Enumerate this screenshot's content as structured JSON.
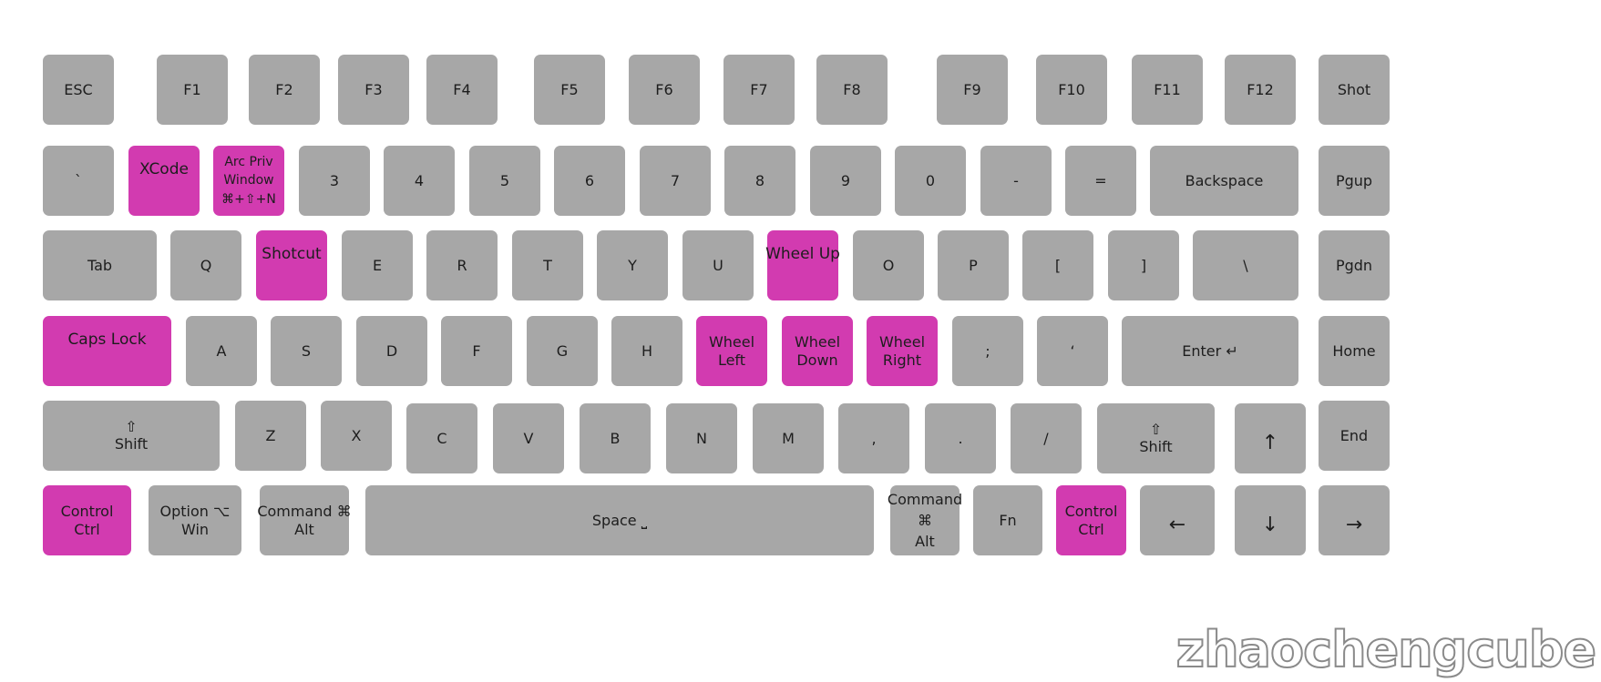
{
  "colors": {
    "key": "#a7a7a7",
    "highlight": "#d23bb0",
    "text": "#1d1d1d"
  },
  "keyboard": {
    "rows": [
      [
        {
          "id": "esc",
          "lines": [
            "ESC"
          ]
        },
        {
          "id": "f1",
          "lines": [
            "F1"
          ]
        },
        {
          "id": "f2",
          "lines": [
            "F2"
          ]
        },
        {
          "id": "f3",
          "lines": [
            "F3"
          ]
        },
        {
          "id": "f4",
          "lines": [
            "F4"
          ]
        },
        {
          "id": "f5",
          "lines": [
            "F5"
          ]
        },
        {
          "id": "f6",
          "lines": [
            "F6"
          ]
        },
        {
          "id": "f7",
          "lines": [
            "F7"
          ]
        },
        {
          "id": "f8",
          "lines": [
            "F8"
          ]
        },
        {
          "id": "f9",
          "lines": [
            "F9"
          ]
        },
        {
          "id": "f10",
          "lines": [
            "F10"
          ]
        },
        {
          "id": "f11",
          "lines": [
            "F11"
          ]
        },
        {
          "id": "f12",
          "lines": [
            "F12"
          ]
        },
        {
          "id": "shot",
          "lines": [
            "Shot"
          ]
        }
      ],
      [
        {
          "id": "backtick",
          "lines": [
            "`"
          ]
        },
        {
          "id": "1",
          "lines": [
            "XCode"
          ],
          "highlight": true
        },
        {
          "id": "2",
          "lines": [
            "Arc Priv",
            "Window",
            "⌘+⇧+N"
          ],
          "highlight": true
        },
        {
          "id": "3",
          "lines": [
            "3"
          ]
        },
        {
          "id": "4",
          "lines": [
            "4"
          ]
        },
        {
          "id": "5",
          "lines": [
            "5"
          ]
        },
        {
          "id": "6",
          "lines": [
            "6"
          ]
        },
        {
          "id": "7",
          "lines": [
            "7"
          ]
        },
        {
          "id": "8",
          "lines": [
            "8"
          ]
        },
        {
          "id": "9",
          "lines": [
            "9"
          ]
        },
        {
          "id": "0",
          "lines": [
            "0"
          ]
        },
        {
          "id": "minus",
          "lines": [
            "-"
          ]
        },
        {
          "id": "equals",
          "lines": [
            "="
          ]
        },
        {
          "id": "backspace",
          "lines": [
            "Backspace"
          ]
        },
        {
          "id": "pgup",
          "lines": [
            "Pgup"
          ]
        }
      ],
      [
        {
          "id": "tab",
          "lines": [
            "Tab"
          ]
        },
        {
          "id": "q",
          "lines": [
            "Q"
          ]
        },
        {
          "id": "w",
          "lines": [
            "Shotcut"
          ],
          "highlight": true
        },
        {
          "id": "e",
          "lines": [
            "E"
          ]
        },
        {
          "id": "r",
          "lines": [
            "R"
          ]
        },
        {
          "id": "t",
          "lines": [
            "T"
          ]
        },
        {
          "id": "y",
          "lines": [
            "Y"
          ]
        },
        {
          "id": "u",
          "lines": [
            "U"
          ]
        },
        {
          "id": "i",
          "lines": [
            "Wheel Up"
          ],
          "highlight": true
        },
        {
          "id": "o",
          "lines": [
            "O"
          ]
        },
        {
          "id": "p",
          "lines": [
            "P"
          ]
        },
        {
          "id": "lbracket",
          "lines": [
            "["
          ]
        },
        {
          "id": "rbracket",
          "lines": [
            "]"
          ]
        },
        {
          "id": "backslash",
          "lines": [
            "\\"
          ]
        },
        {
          "id": "pgdn",
          "lines": [
            "Pgdn"
          ]
        }
      ],
      [
        {
          "id": "capslock",
          "lines": [
            "Caps Lock"
          ],
          "highlight": true
        },
        {
          "id": "a",
          "lines": [
            "A"
          ]
        },
        {
          "id": "s",
          "lines": [
            "S"
          ]
        },
        {
          "id": "d",
          "lines": [
            "D"
          ]
        },
        {
          "id": "f",
          "lines": [
            "F"
          ]
        },
        {
          "id": "g",
          "lines": [
            "G"
          ]
        },
        {
          "id": "h",
          "lines": [
            "H"
          ]
        },
        {
          "id": "j",
          "lines": [
            "Wheel",
            "Left"
          ],
          "highlight": true
        },
        {
          "id": "k",
          "lines": [
            "Wheel",
            "Down"
          ],
          "highlight": true
        },
        {
          "id": "l",
          "lines": [
            "Wheel",
            "Right"
          ],
          "highlight": true
        },
        {
          "id": "semicolon",
          "lines": [
            ";"
          ]
        },
        {
          "id": "quote",
          "lines": [
            "‘"
          ]
        },
        {
          "id": "enter",
          "lines": [
            "Enter ↵"
          ]
        },
        {
          "id": "home",
          "lines": [
            "Home"
          ]
        }
      ],
      [
        {
          "id": "lshift",
          "lines": [
            "⇧",
            "Shift"
          ]
        },
        {
          "id": "z",
          "lines": [
            "Z"
          ]
        },
        {
          "id": "x",
          "lines": [
            "X"
          ]
        },
        {
          "id": "c",
          "lines": [
            "C"
          ]
        },
        {
          "id": "v",
          "lines": [
            "V"
          ]
        },
        {
          "id": "b",
          "lines": [
            "B"
          ]
        },
        {
          "id": "n",
          "lines": [
            "N"
          ]
        },
        {
          "id": "m",
          "lines": [
            "M"
          ]
        },
        {
          "id": "comma",
          "lines": [
            ","
          ]
        },
        {
          "id": "period",
          "lines": [
            "."
          ]
        },
        {
          "id": "slash",
          "lines": [
            "/"
          ]
        },
        {
          "id": "rshift",
          "lines": [
            "⇧",
            "Shift"
          ]
        },
        {
          "id": "up",
          "lines": [
            "↑"
          ]
        },
        {
          "id": "end",
          "lines": [
            "End"
          ]
        }
      ],
      [
        {
          "id": "lctrl",
          "lines": [
            "Control",
            "Ctrl"
          ],
          "highlight": true
        },
        {
          "id": "loption",
          "lines": [
            "Option ⌥",
            "Win"
          ]
        },
        {
          "id": "lcommand",
          "lines": [
            "Command ⌘",
            "Alt"
          ]
        },
        {
          "id": "space",
          "lines": [
            "Space ⎵"
          ]
        },
        {
          "id": "rcommand",
          "lines": [
            "Command",
            "⌘",
            "Alt"
          ]
        },
        {
          "id": "fn",
          "lines": [
            "Fn"
          ]
        },
        {
          "id": "rctrl",
          "lines": [
            "Control",
            "Ctrl"
          ],
          "highlight": true
        },
        {
          "id": "left",
          "lines": [
            "←"
          ]
        },
        {
          "id": "down",
          "lines": [
            "↓"
          ]
        },
        {
          "id": "right",
          "lines": [
            "→"
          ]
        }
      ]
    ]
  },
  "watermark": "zhaochengcube"
}
